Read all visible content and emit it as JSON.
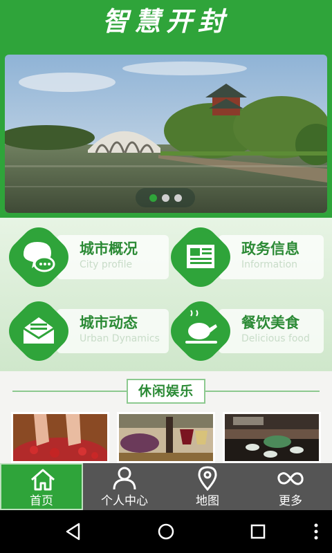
{
  "header": {
    "title": "智慧开封"
  },
  "banner": {
    "slide_count": 3,
    "active_index": 0
  },
  "categories": [
    {
      "cn": "城市概况",
      "en": "City profile",
      "icon": "chat-bubble-icon"
    },
    {
      "cn": "政务信息",
      "en": "Information",
      "icon": "newspaper-icon"
    },
    {
      "cn": "城市动态",
      "en": "Urban Dynamics",
      "icon": "envelope-icon"
    },
    {
      "cn": "餐饮美食",
      "en": "Delicious food",
      "icon": "roast-chicken-icon"
    }
  ],
  "leisure": {
    "title": "休闲娱乐",
    "items": [
      "footbath-photo",
      "wine-photo",
      "tea-set-photo"
    ]
  },
  "tabs": [
    {
      "label": "首页",
      "icon": "home-icon",
      "active": true
    },
    {
      "label": "个人中心",
      "icon": "user-icon",
      "active": false
    },
    {
      "label": "地图",
      "icon": "map-pin-icon",
      "active": false
    },
    {
      "label": "更多",
      "icon": "infinity-icon",
      "active": false
    }
  ],
  "system": {
    "buttons": [
      "back-icon",
      "home-circle-icon",
      "recents-icon",
      "overflow-menu-icon"
    ]
  },
  "colors": {
    "primary": "#2fa43a",
    "tabbar": "#555555",
    "accent_text": "#2b8a35"
  }
}
